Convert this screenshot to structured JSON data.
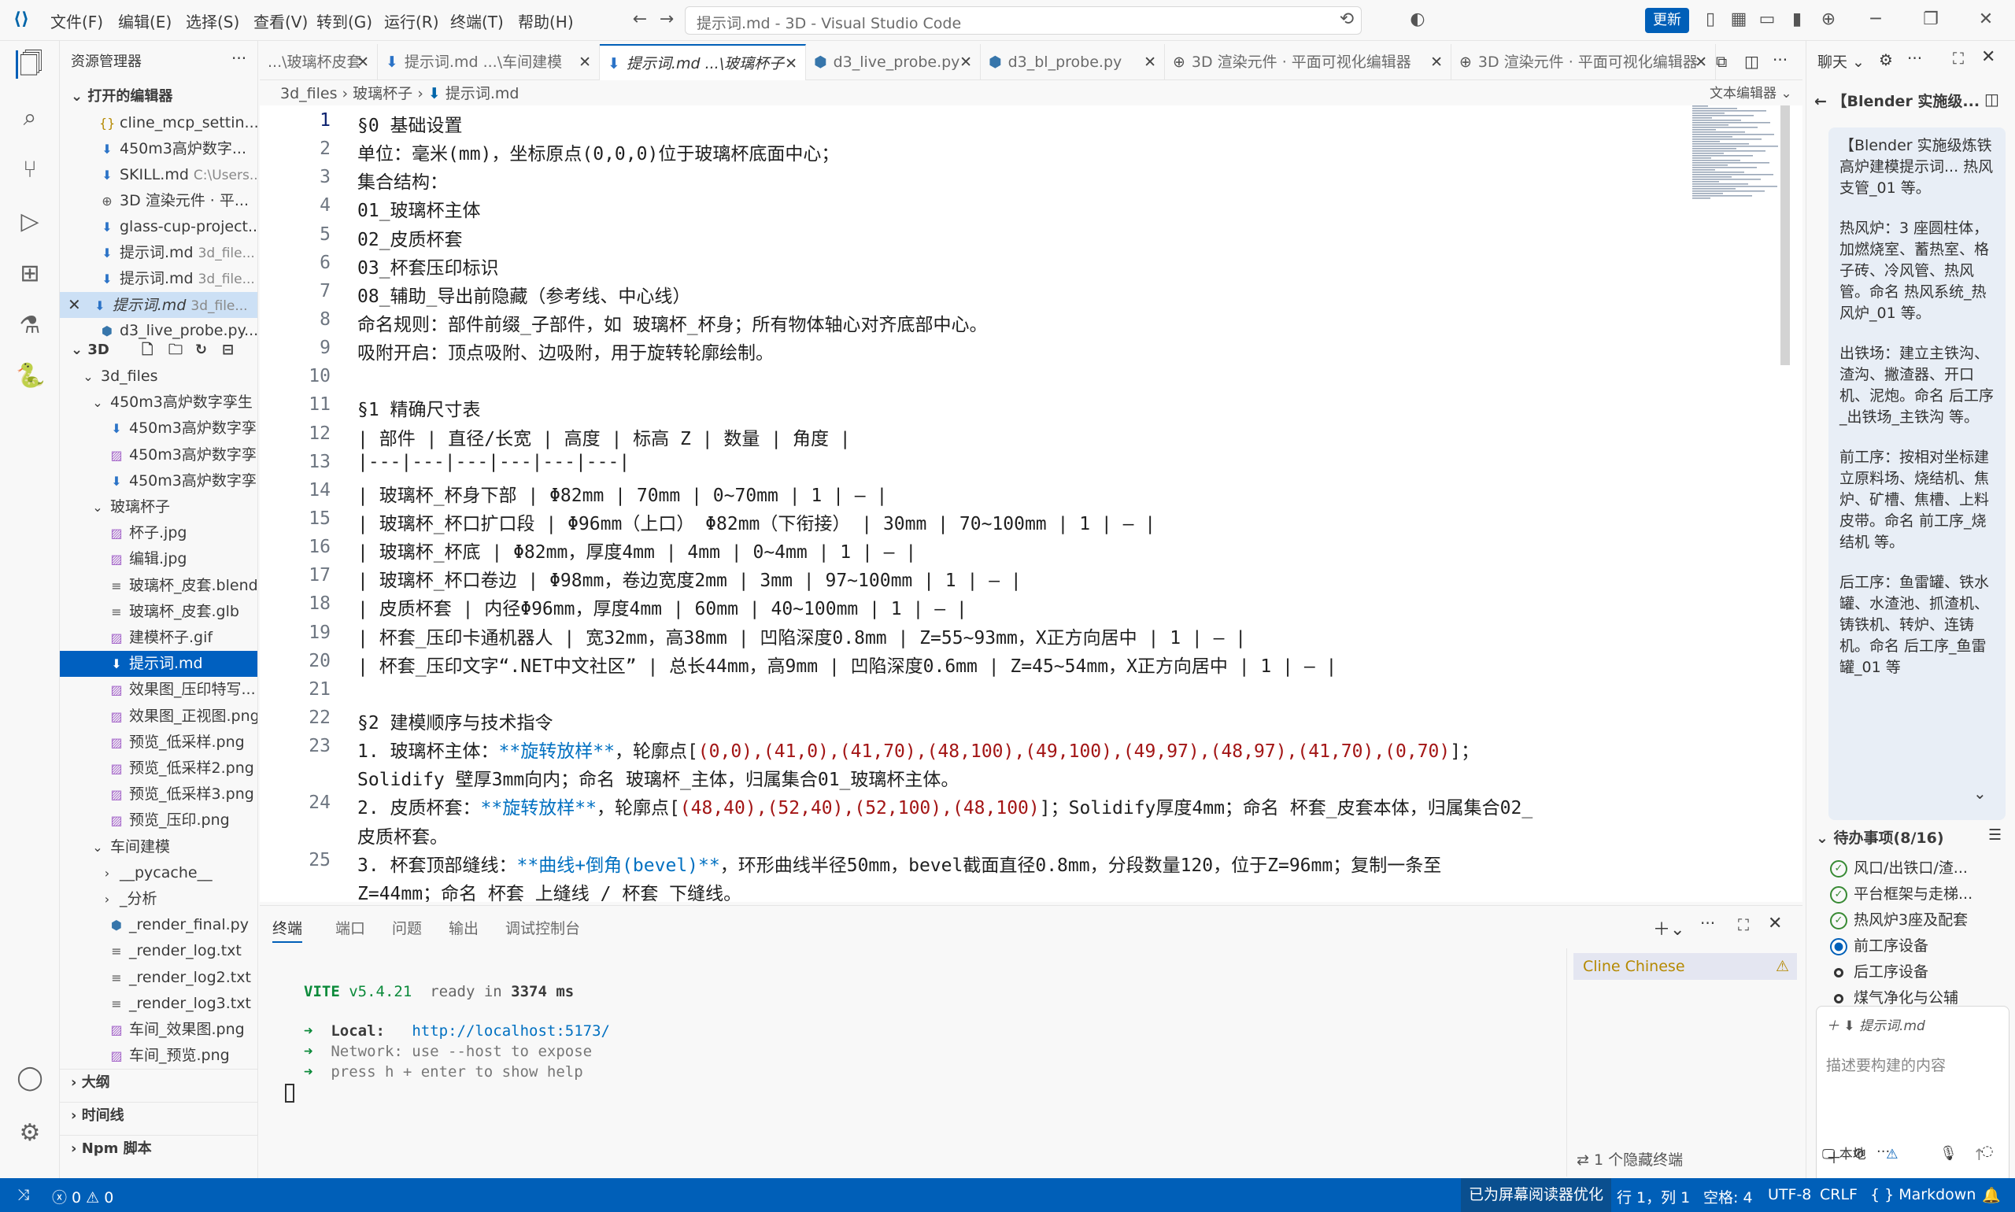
{
  "window": {
    "title": "提示词.md - 3D - Visual Studio Code",
    "menu": [
      "文件(F)",
      "编辑(E)",
      "选择(S)",
      "查看(V)",
      "转到(G)",
      "运行(R)",
      "终端(T)",
      "帮助(H)"
    ],
    "update_label": "更新"
  },
  "sidebar": {
    "title": "资源管理器",
    "open_editors_label": "打开的编辑器",
    "open_editors": [
      {
        "name": "cline_mcp_settin...",
        "hint": "",
        "icon": "{}"
      },
      {
        "name": "450m3高炉数字...",
        "hint": "",
        "icon": "md"
      },
      {
        "name": "SKILL.md",
        "hint": "C:\\Users...",
        "icon": "md"
      },
      {
        "name": "3D 渲染元件 · 平...",
        "hint": "",
        "icon": "globe"
      },
      {
        "name": "glass-cup-project...",
        "hint": "",
        "icon": "md"
      },
      {
        "name": "提示词.md",
        "hint": "3d_file...",
        "icon": "md"
      },
      {
        "name": "提示词.md",
        "hint": "3d_file...",
        "icon": "md"
      },
      {
        "name": "提示词.md",
        "hint": "3d_file...",
        "icon": "md"
      },
      {
        "name": "d3_live_probe.py...",
        "hint": "",
        "icon": "py"
      }
    ],
    "folder_label": "3D",
    "tree": [
      {
        "name": "3d_files",
        "level": 1,
        "kind": "folder"
      },
      {
        "name": "450m3高炉数字孪生",
        "level": 2,
        "kind": "folder"
      },
      {
        "name": "450m3高炉数字孪...",
        "level": 3,
        "kind": "md"
      },
      {
        "name": "450m3高炉数字孪...",
        "level": 3,
        "kind": "img"
      },
      {
        "name": "450m3高炉数字孪...",
        "level": 3,
        "kind": "md"
      },
      {
        "name": "玻璃杯子",
        "level": 2,
        "kind": "folder"
      },
      {
        "name": "杯子.jpg",
        "level": 3,
        "kind": "img"
      },
      {
        "name": "编辑.jpg",
        "level": 3,
        "kind": "img"
      },
      {
        "name": "玻璃杯_皮套.blend",
        "level": 3,
        "kind": "txt"
      },
      {
        "name": "玻璃杯_皮套.glb",
        "level": 3,
        "kind": "txt"
      },
      {
        "name": "建模杯子.gif",
        "level": 3,
        "kind": "img"
      },
      {
        "name": "提示词.md",
        "level": 3,
        "kind": "md"
      },
      {
        "name": "效果图_压印特写...",
        "level": 3,
        "kind": "img"
      },
      {
        "name": "效果图_正视图.png",
        "level": 3,
        "kind": "img"
      },
      {
        "name": "预览_低采样.png",
        "level": 3,
        "kind": "img"
      },
      {
        "name": "预览_低采样2.png",
        "level": 3,
        "kind": "img"
      },
      {
        "name": "预览_低采样3.png",
        "level": 3,
        "kind": "img"
      },
      {
        "name": "预览_压印.png",
        "level": 3,
        "kind": "img"
      },
      {
        "name": "车间建模",
        "level": 2,
        "kind": "folder"
      },
      {
        "name": "__pycache__",
        "level": 3,
        "kind": "collapsed"
      },
      {
        "name": "_分析",
        "level": 3,
        "kind": "collapsed"
      },
      {
        "name": "_render_final.py",
        "level": 3,
        "kind": "py"
      },
      {
        "name": "_render_log.txt",
        "level": 3,
        "kind": "txt"
      },
      {
        "name": "_render_log2.txt",
        "level": 3,
        "kind": "txt"
      },
      {
        "name": "_render_log3.txt",
        "level": 3,
        "kind": "txt"
      },
      {
        "name": "车间_效果图.png",
        "level": 3,
        "kind": "img"
      },
      {
        "name": "车间_预览.png",
        "level": 3,
        "kind": "img"
      }
    ],
    "outline_label": "大纲",
    "timeline_label": "时间线",
    "npm_label": "Npm 脚本"
  },
  "tabs": [
    {
      "label": "...\\玻璃杯皮套",
      "active": false
    },
    {
      "label": "提示词.md ...\\车间建模",
      "active": false
    },
    {
      "label": "提示词.md ...\\玻璃杯子",
      "active": true
    },
    {
      "label": "d3_live_probe.py",
      "active": false
    },
    {
      "label": "d3_bl_probe.py",
      "active": false
    },
    {
      "label": "3D 渲染元件 · 平面可视化编辑器",
      "active": false
    },
    {
      "label": "3D 渲染元件 · 平面可视化编辑器",
      "active": false
    }
  ],
  "breadcrumb": [
    "3d_files",
    "玻璃杯子",
    "提示词.md"
  ],
  "editor_mode_label": "文本编辑器",
  "code_lines": [
    {
      "n": "1",
      "text": "§0 基础设置"
    },
    {
      "n": "2",
      "text": "单位：毫米(mm)，坐标原点(0,0,0)位于玻璃杯底面中心；"
    },
    {
      "n": "3",
      "text": "集合结构："
    },
    {
      "n": "4",
      "text": "01_玻璃杯主体"
    },
    {
      "n": "5",
      "text": "02_皮质杯套"
    },
    {
      "n": "6",
      "text": "03_杯套压印标识"
    },
    {
      "n": "7",
      "text": "08_辅助_导出前隐藏（参考线、中心线）"
    },
    {
      "n": "8",
      "text": "命名规则：部件前缀_子部件，如 玻璃杯_杯身；所有物体轴心对齐底部中心。"
    },
    {
      "n": "9",
      "text": "吸附开启：顶点吸附、边吸附，用于旋转轮廓绘制。"
    },
    {
      "n": "10",
      "text": ""
    },
    {
      "n": "11",
      "text": "§1 精确尺寸表"
    },
    {
      "n": "12",
      "text": "| 部件 | 直径/长宽 | 高度 | 标高 Z | 数量 | 角度 |"
    },
    {
      "n": "13",
      "text": "|---|---|---|---|---|---|"
    },
    {
      "n": "14",
      "text": "| 玻璃杯_杯身下部 | Φ82mm | 70mm | 0~70mm | 1 | — |"
    },
    {
      "n": "15",
      "text": "| 玻璃杯_杯口扩口段 | Φ96mm（上口） Φ82mm（下衔接） | 30mm | 70~100mm | 1 | — |"
    },
    {
      "n": "16",
      "text": "| 玻璃杯_杯底 | Φ82mm，厚度4mm | 4mm | 0~4mm | 1 | — |"
    },
    {
      "n": "17",
      "text": "| 玻璃杯_杯口卷边 | Φ98mm，卷边宽度2mm | 3mm | 97~100mm | 1 | — |"
    },
    {
      "n": "18",
      "text": "| 皮质杯套 | 内径Φ96mm，厚度4mm | 60mm | 40~100mm | 1 | — |"
    },
    {
      "n": "19",
      "text": "| 杯套_压印卡通机器人 | 宽32mm，高38mm | 凹陷深度0.8mm | Z=55~93mm，X正方向居中 | 1 | — |"
    },
    {
      "n": "20",
      "text": "| 杯套_压印文字“.NET中文社区” | 总长44mm，高9mm | 凹陷深度0.6mm | Z=45~54mm，X正方向居中 | 1 | — |"
    },
    {
      "n": "21",
      "text": ""
    },
    {
      "n": "22",
      "text": "§2 建模顺序与技术指令"
    },
    {
      "n": "23",
      "pre": "1. 玻璃杯主体：",
      "kw": "**旋转放样**",
      "mid": "，轮廓点[",
      "nums": "(0,0),(41,0),(41,70),(48,100),(49,100),(49,97),(48,97),(41,70),(0,70)",
      "post": "]；"
    },
    {
      "n": "",
      "text": "Solidify 壁厚3mm向内；命名 玻璃杯_主体，归属集合01_玻璃杯主体。"
    },
    {
      "n": "24",
      "pre": "2. 皮质杯套：",
      "kw": "**旋转放样**",
      "mid": "，轮廓点[",
      "nums": "(48,40),(52,40),(52,100),(48,100)",
      "post": "]；Solidify厚度4mm；命名 杯套_皮套本体，归属集合02_"
    },
    {
      "n": "",
      "text": "皮质杯套。"
    },
    {
      "n": "25",
      "pre": "3. 杯套顶部缝线：",
      "kw": "**曲线+倒角(bevel)**",
      "mid": "，环形曲线半径50mm，bevel截面直径0.8mm，分段数量120，位于Z=96mm；复制一条至",
      "nums": "",
      "post": ""
    },
    {
      "n": "",
      "text": "Z=44mm；命名 杯套_上缝线 / 杯套_下缝线。"
    }
  ],
  "panel": {
    "tabs": [
      "终端",
      "端口",
      "问题",
      "输出",
      "调试控制台"
    ],
    "terminal": {
      "vite_name": "VITE",
      "vite_version": "v5.4.21",
      "ready_text": "ready in",
      "ready_ms": "3374 ms",
      "local_label": "Local:",
      "local_url": "http://localhost:5173/",
      "network_line": "Network: use --host to expose",
      "help_line": "press h + enter to show help"
    },
    "side_terminal_name": "Cline Chinese",
    "hidden_terminals": "1 个隐藏终端"
  },
  "chat": {
    "tab_label": "聊天",
    "title": "【Blender 实施级...",
    "paragraphs": [
      "【Blender 实施级炼铁高炉建模提示词... 热风支管_01 等。",
      "热风炉：3 座圆柱体，加燃烧室、蓄热室、格子砖、冷风管、热风管。命名 热风系统_热风炉_01 等。",
      "出铁场：建立主铁沟、渣沟、撇渣器、开口机、泥炮。命名 后工序_出铁场_主铁沟 等。",
      "前工序：按相对坐标建立原料场、烧结机、焦炉、矿槽、焦槽、上料皮带。命名 前工序_烧结机 等。",
      "后工序：鱼雷罐、铁水罐、水渣池、抓渣机、铸铁机、转炉、连铸机。命名 后工序_鱼雷罐_01 等"
    ],
    "todo_title": "待办事项(8/16)",
    "todos": [
      {
        "label": "风口/出铁口/渣...",
        "state": "done"
      },
      {
        "label": "平台框架与走梯...",
        "state": "done"
      },
      {
        "label": "热风炉3座及配套",
        "state": "done"
      },
      {
        "label": "前工序设备",
        "state": "current"
      },
      {
        "label": "后工序设备",
        "state": "pending"
      },
      {
        "label": "煤气净化与公辅",
        "state": "pending"
      }
    ],
    "context_file": "提示词.md",
    "input_placeholder": "描述要构建的内容",
    "local_label": "本地"
  },
  "status": {
    "errors": "0",
    "warnings": "0",
    "screen_reader": "已为屏幕阅读器优化",
    "position": "行 1，列 1",
    "spaces": "空格: 4",
    "encoding": "UTF-8",
    "eol": "CRLF",
    "language": "Markdown"
  },
  "colors": {
    "accent": "#005fb8",
    "status_bar": "#005fb8",
    "keyword": "#0070c1",
    "number": "#a31515"
  }
}
